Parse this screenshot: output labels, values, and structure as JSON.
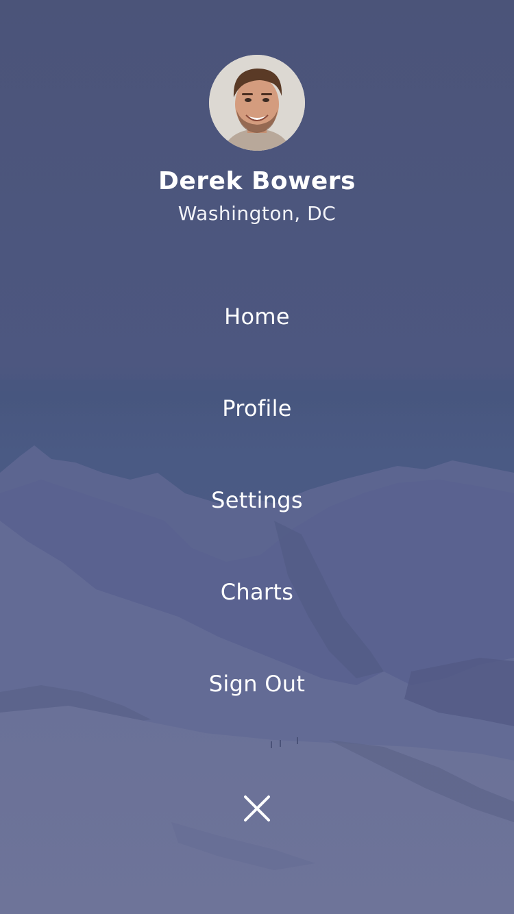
{
  "app": {
    "theme": {
      "overlay_color": "#4a5478",
      "text_color": "#ffffff"
    }
  },
  "profile": {
    "name": "Derek Bowers",
    "location": "Washington, DC",
    "avatar_icon": "user-photo"
  },
  "menu": {
    "items": [
      {
        "label": "Home"
      },
      {
        "label": "Profile"
      },
      {
        "label": "Settings"
      },
      {
        "label": "Charts"
      },
      {
        "label": "Sign Out"
      }
    ]
  },
  "close": {
    "icon": "close-icon"
  }
}
